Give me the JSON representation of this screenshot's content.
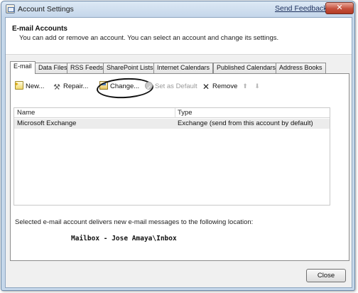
{
  "window": {
    "title": "Account Settings",
    "feedback_link": "Send Feedback",
    "close_glyph": "✕"
  },
  "header": {
    "title": "E-mail Accounts",
    "description": "You can add or remove an account. You can select an account and change its settings."
  },
  "tabs": [
    {
      "label": "E-mail",
      "active": true
    },
    {
      "label": "Data Files"
    },
    {
      "label": "RSS Feeds"
    },
    {
      "label": "SharePoint Lists"
    },
    {
      "label": "Internet Calendars"
    },
    {
      "label": "Published Calendars"
    },
    {
      "label": "Address Books"
    }
  ],
  "toolbar": {
    "new_label": "New...",
    "repair_label": "Repair...",
    "change_label": "Change...",
    "set_default_label": "Set as Default",
    "remove_label": "Remove",
    "up_glyph": "⬆",
    "down_glyph": "⬇"
  },
  "account_list": {
    "columns": [
      "Name",
      "Type"
    ],
    "rows": [
      {
        "name": "Microsoft Exchange",
        "type": "Exchange (send from this account by default)"
      }
    ]
  },
  "delivery": {
    "label": "Selected e-mail account delivers new e-mail messages to the following location:",
    "location": "Mailbox - Jose Amaya\\Inbox"
  },
  "footer": {
    "close_label": "Close"
  }
}
